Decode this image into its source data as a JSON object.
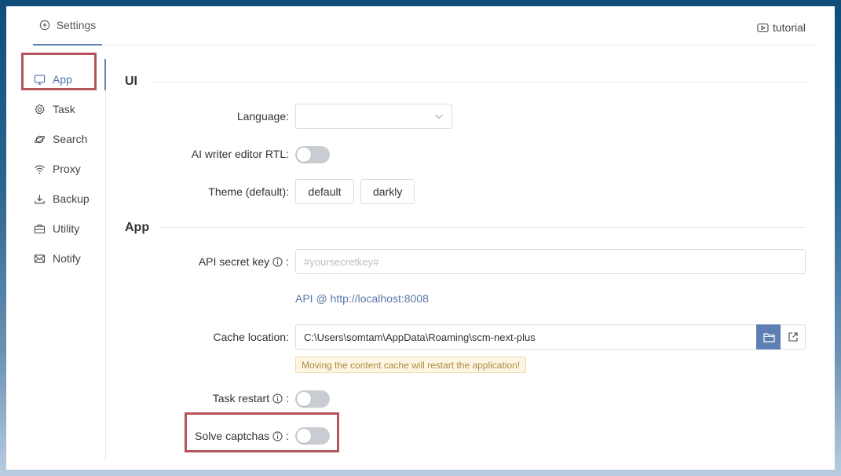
{
  "header": {
    "settings_tab": "Settings",
    "tutorial_link": "tutorial"
  },
  "sidebar": {
    "items": [
      {
        "label": "App",
        "icon": "monitor-icon"
      },
      {
        "label": "Task",
        "icon": "gear-icon"
      },
      {
        "label": "Search",
        "icon": "planet-icon"
      },
      {
        "label": "Proxy",
        "icon": "wifi-icon"
      },
      {
        "label": "Backup",
        "icon": "download-icon"
      },
      {
        "label": "Utility",
        "icon": "briefcase-icon"
      },
      {
        "label": "Notify",
        "icon": "mail-icon"
      }
    ],
    "active": "App"
  },
  "ui_section": {
    "title": "UI",
    "language_label": "Language:",
    "language_value": "",
    "rtl_label": "AI writer editor RTL:",
    "rtl_on": false,
    "theme_label": "Theme (default):",
    "theme_options": [
      "default",
      "darkly"
    ]
  },
  "app_section": {
    "title": "App",
    "api_key_label": "API secret key",
    "api_key_placeholder": "#yoursecretkey#",
    "api_link": "API @ http://localhost:8008",
    "cache_label": "Cache location:",
    "cache_value": "C:\\Users\\somtam\\AppData\\Roaming\\scm-next-plus",
    "cache_warning": "Moving the content cache will restart the application!",
    "task_restart_label": "Task restart",
    "task_restart_on": false,
    "solve_captchas_label": "Solve captchas",
    "solve_captchas_on": false,
    "colon": ":"
  },
  "colors": {
    "accent": "#6583b2",
    "highlight_box": "#b5545c",
    "warning_text": "#b0893d"
  }
}
